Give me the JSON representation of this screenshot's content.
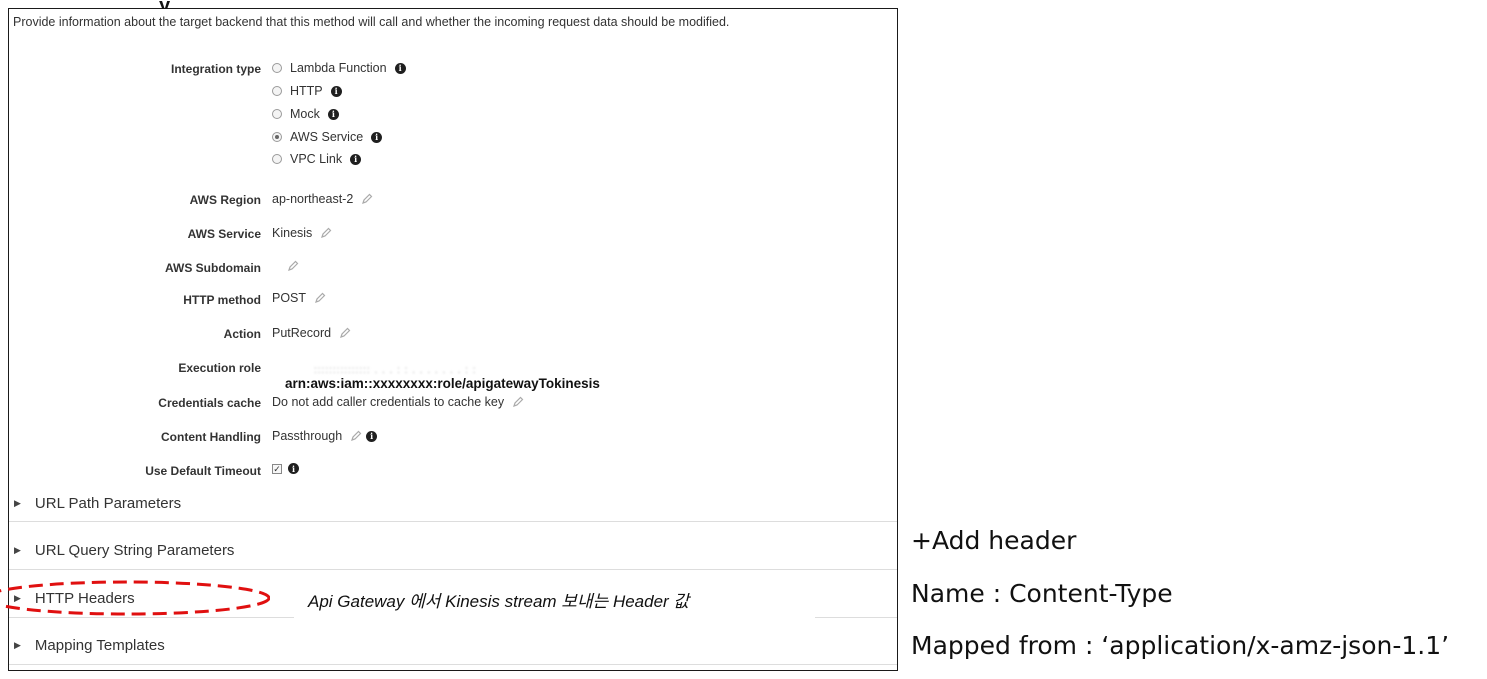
{
  "intro": "Provide information about the target backend that this method will call and whether the incoming request data should be modified.",
  "integration_type": {
    "label": "Integration type",
    "options": [
      {
        "label": "Lambda Function",
        "checked": false
      },
      {
        "label": "HTTP",
        "checked": false
      },
      {
        "label": "Mock",
        "checked": false
      },
      {
        "label": "AWS Service",
        "checked": true
      },
      {
        "label": "VPC Link",
        "checked": false
      }
    ]
  },
  "fields": {
    "aws_region": {
      "label": "AWS Region",
      "value": "ap-northeast-2"
    },
    "aws_service": {
      "label": "AWS Service",
      "value": "Kinesis"
    },
    "aws_subdomain": {
      "label": "AWS Subdomain",
      "value": ""
    },
    "http_method": {
      "label": "HTTP method",
      "value": "POST"
    },
    "action": {
      "label": "Action",
      "value": "PutRecord"
    },
    "execution_role": {
      "label": "Execution role",
      "value": "arn:aws:iam::xxxxxxxx:role/apigatewayTokinesis"
    },
    "credentials_cache": {
      "label": "Credentials cache",
      "value": "Do not add caller credentials to cache key"
    },
    "content_handling": {
      "label": "Content Handling",
      "value": "Passthrough"
    },
    "default_timeout": {
      "label": "Use Default Timeout",
      "checked": true
    }
  },
  "sections": [
    {
      "title": "URL Path Parameters"
    },
    {
      "title": "URL Query String Parameters"
    },
    {
      "title": "HTTP Headers"
    },
    {
      "title": "Mapping Templates"
    }
  ],
  "annotation": "Api Gateway 에서 Kinesis stream 보내는 Header 값",
  "side_notes": {
    "add_header": "+Add header",
    "name": "Name : Content-Type",
    "mapped_from": "Mapped from : ‘application/x-amz-json-1.1’"
  },
  "colors": {
    "annotation_ellipse": "#e01010",
    "info_icon": "#1f1f1f"
  },
  "icons": [
    "info-icon",
    "pencil-icon",
    "chevron-right-icon",
    "radio-icon",
    "checkbox-icon"
  ]
}
